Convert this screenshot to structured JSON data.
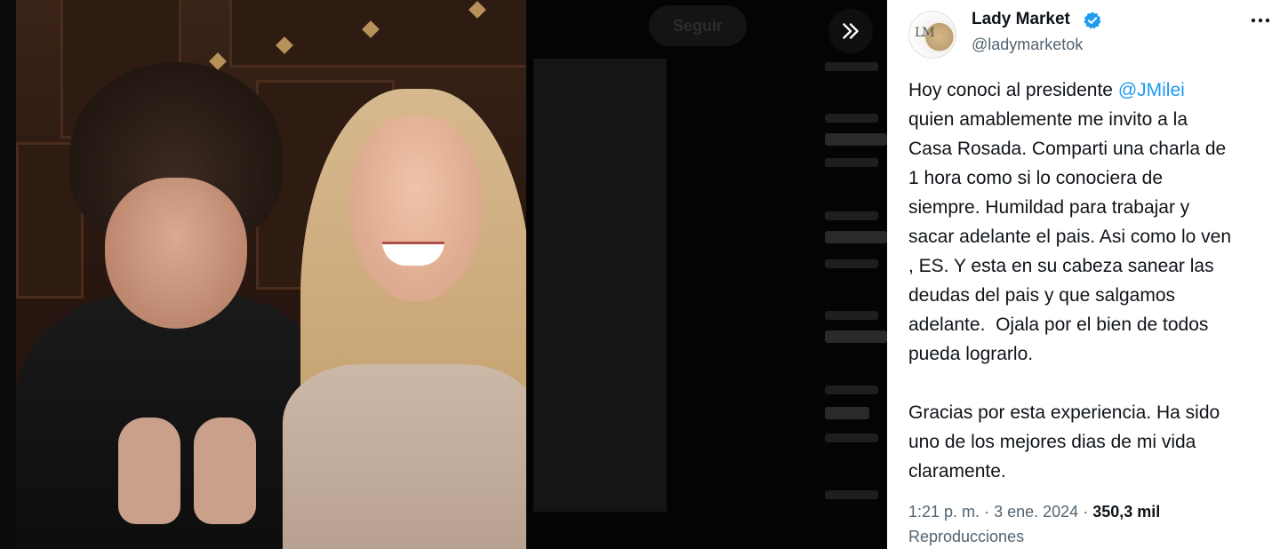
{
  "media": {
    "follow_label": "Seguir"
  },
  "tweet": {
    "display_name": "Lady Market",
    "handle": "@ladymarketok",
    "avatar_monogram": "LM",
    "text_before_mention": "Hoy conoci al presidente ",
    "mention": "@JMilei",
    "text_after_mention": "\nquien amablemente me invito a la\nCasa Rosada. Comparti una charla de\n1 hora como si lo conociera de\nsiempre. Humildad para trabajar y\nsacar adelante el pais. Asi como lo ven\n, ES. Y esta en su cabeza sanear las\ndeudas del pais y que salgamos\nadelante.  Ojala por el bien de todos\npueda lograrlo.\n\nGracias por esta experiencia. Ha sido\nuno de los mejores dias de mi vida\nclaramente.",
    "time": "1:21 p. m.",
    "date": "3 ene. 2024",
    "separator": "·",
    "views_count": "350,3 mil",
    "views_label": "Reproducciones"
  },
  "colors": {
    "accent": "#1d9bf0",
    "text_primary": "#0f1419",
    "text_secondary": "#536471",
    "panel_bg": "#ffffff",
    "media_bg": "#000000"
  },
  "icons": {
    "verified": "verified-badge-icon",
    "expand": "chevrons-right-icon",
    "more": "more-horizontal-icon"
  }
}
